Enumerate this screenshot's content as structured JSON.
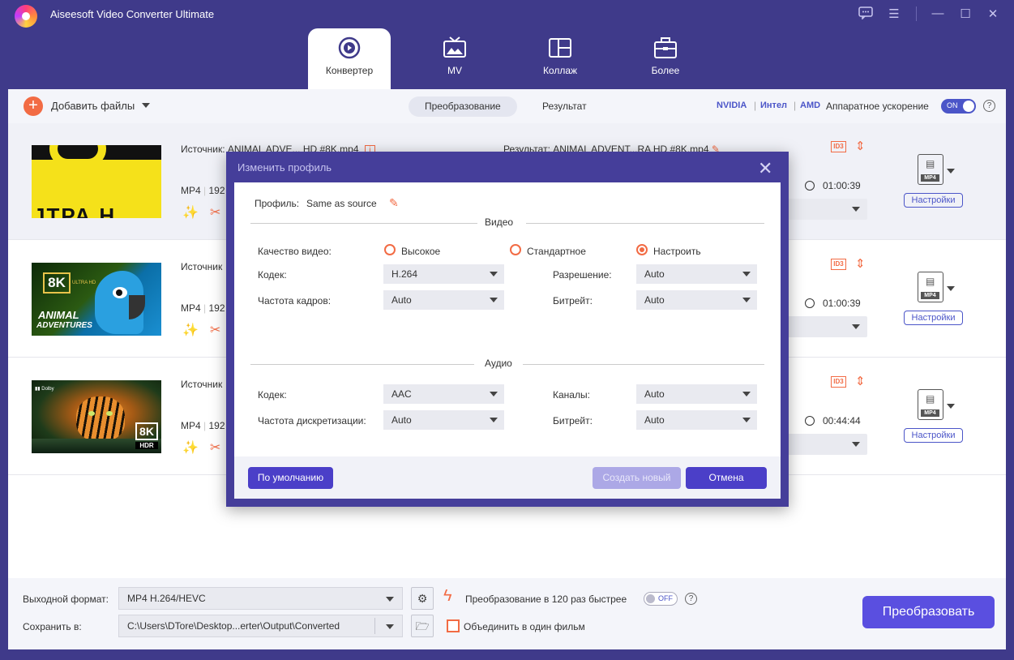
{
  "app": {
    "title": "Aiseesoft Video Converter Ultimate"
  },
  "nav": {
    "tabs": [
      {
        "label": "Конвертер"
      },
      {
        "label": "MV"
      },
      {
        "label": "Коллаж"
      },
      {
        "label": "Более"
      }
    ]
  },
  "toolbar": {
    "add_files": "Добавить файлы",
    "tab_convert": "Преобразование",
    "tab_result": "Результат",
    "nvidia": "NVIDIA",
    "intel": "Интел",
    "amd": "AMD",
    "hw_accel": "Аппаратное ускорение",
    "toggle_on": "ON"
  },
  "files": [
    {
      "source": "Источник: ANIMAL ADVE... HD #8K.mp4",
      "format": "MP4",
      "resolution": "192",
      "result": "Результат: ANIMAL ADVENT...RA HD #8K.mp4",
      "duration": "01:00:39",
      "settings": "Настройки",
      "badge": "MP4",
      "thumb_text": "ЈТРА Н"
    },
    {
      "source": "Источник",
      "format": "MP4",
      "resolution": "192",
      "duration": "01:00:39",
      "settings": "Настройки",
      "badge": "MP4",
      "thumb_badge": "8K",
      "thumb_sub": "ULTRA HD",
      "thumb_text1": "ANIMAL",
      "thumb_text2": "ADVENTURES"
    },
    {
      "source": "Источник",
      "format": "MP4",
      "resolution": "192",
      "duration": "00:44:44",
      "settings": "Настройки",
      "badge": "MP4",
      "thumb_badge": "8K",
      "thumb_sub": "HDR"
    }
  ],
  "bottom": {
    "output_format_label": "Выходной формат:",
    "output_format_value": "MP4 H.264/HEVC",
    "save_to_label": "Сохранить в:",
    "save_to_value": "C:\\Users\\DTore\\Desktop...erter\\Output\\Converted",
    "fast_label": "Преобразование в 120 раз быстрее",
    "toggle_off": "OFF",
    "merge_label": "Объединить в один фильм",
    "convert_button": "Преобразовать"
  },
  "dialog": {
    "title": "Изменить профиль",
    "profile_label": "Профиль:",
    "profile_value": "Same as source",
    "video_section": "Видео",
    "quality_label": "Качество видео:",
    "quality_high": "Высокое",
    "quality_standard": "Стандартное",
    "quality_custom": "Настроить",
    "video_codec_label": "Кодек:",
    "video_codec_value": "H.264",
    "resolution_label": "Разрешение:",
    "resolution_value": "Auto",
    "framerate_label": "Частота кадров:",
    "framerate_value": "Auto",
    "video_bitrate_label": "Битрейт:",
    "video_bitrate_value": "Auto",
    "audio_section": "Аудио",
    "audio_codec_label": "Кодек:",
    "audio_codec_value": "AAC",
    "channels_label": "Каналы:",
    "channels_value": "Auto",
    "samplerate_label": "Частота дискретизации:",
    "samplerate_value": "Auto",
    "audio_bitrate_label": "Битрейт:",
    "audio_bitrate_value": "Auto",
    "default_button": "По умолчанию",
    "create_button": "Создать новый",
    "cancel_button": "Отмена"
  },
  "colors": {
    "accent": "#4b55c8",
    "orange": "#f26b44",
    "titlebar": "#3f3a8a",
    "dialog_frame": "#453e9a"
  }
}
